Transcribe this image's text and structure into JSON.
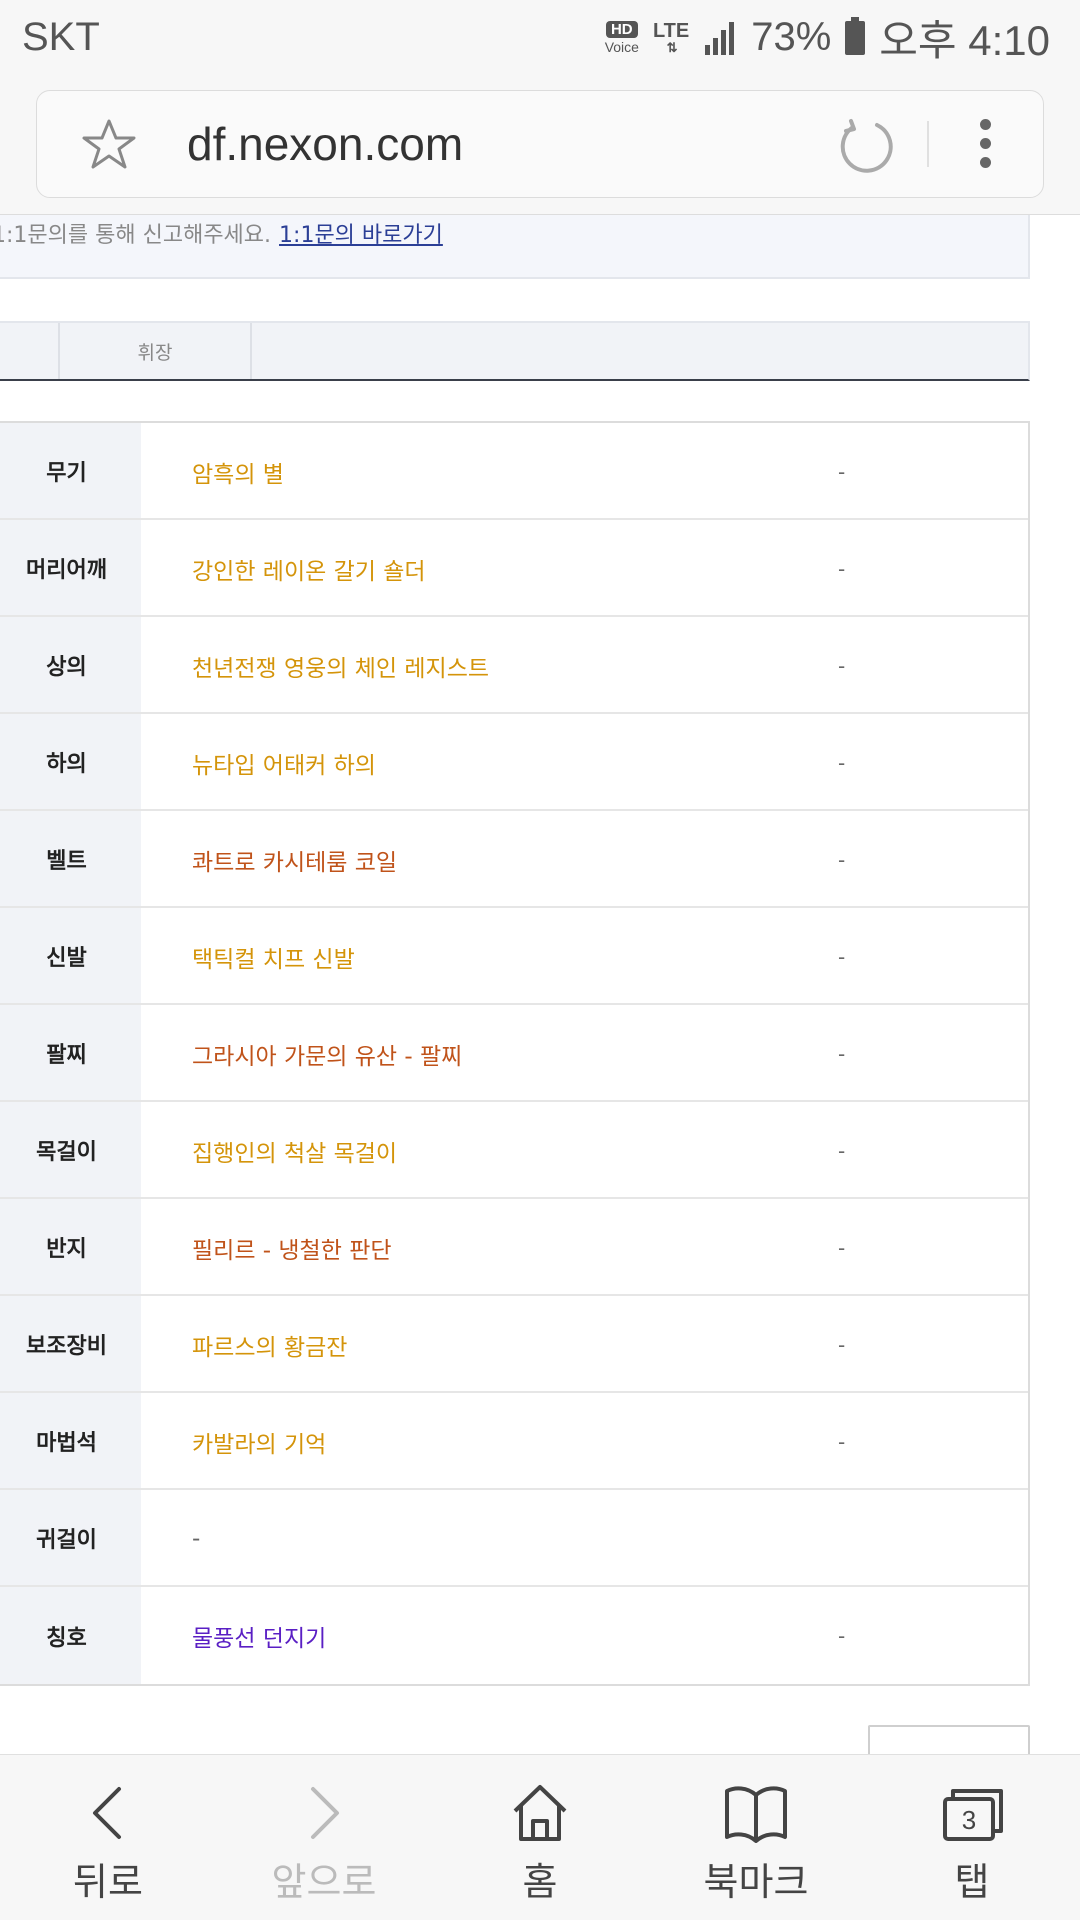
{
  "status_bar": {
    "carrier": "SKT",
    "hd": "HD",
    "voice": "Voice",
    "network": "LTE",
    "battery": "73%",
    "time": "오후 4:10"
  },
  "browser": {
    "url": "df.nexon.com"
  },
  "notice": {
    "text": "1:1문의를 통해 신고해주세요.",
    "link": "1:1문의 바로가기"
  },
  "tabs": {
    "active": "휘장"
  },
  "equipment": [
    {
      "slot": "무기",
      "item": "암흑의 별",
      "color": "#d4940a",
      "extra": "-"
    },
    {
      "slot": "머리어깨",
      "item": "강인한 레이온 갈기 숄더",
      "color": "#d4940a",
      "extra": "-"
    },
    {
      "slot": "상의",
      "item": "천년전쟁 영웅의 체인 레지스트",
      "color": "#d4940a",
      "extra": "-"
    },
    {
      "slot": "하의",
      "item": "뉴타입 어태커 하의",
      "color": "#d4940a",
      "extra": "-"
    },
    {
      "slot": "벨트",
      "item": "콰트로 카시테룸 코일",
      "color": "#c0531a",
      "extra": "-"
    },
    {
      "slot": "신발",
      "item": "택틱컬 치프 신발",
      "color": "#d4940a",
      "extra": "-"
    },
    {
      "slot": "팔찌",
      "item": "그라시아 가문의 유산 - 팔찌",
      "color": "#c0531a",
      "extra": "-"
    },
    {
      "slot": "목걸이",
      "item": "집행인의 척살 목걸이",
      "color": "#d4940a",
      "extra": "-"
    },
    {
      "slot": "반지",
      "item": "필리르 - 냉철한 판단",
      "color": "#c0531a",
      "extra": "-"
    },
    {
      "slot": "보조장비",
      "item": "파르스의 황금잔",
      "color": "#d4940a",
      "extra": "-"
    },
    {
      "slot": "마법석",
      "item": "카발라의 기억",
      "color": "#d4940a",
      "extra": "-"
    },
    {
      "slot": "귀걸이",
      "item": "-",
      "color": "#666666",
      "extra": ""
    },
    {
      "slot": "칭호",
      "item": "물풍선 던지기",
      "color": "#5a1fc4",
      "extra": "-"
    }
  ],
  "bottom_nav": {
    "back": "뒤로",
    "forward": "앞으로",
    "home": "홈",
    "bookmarks": "북마크",
    "tabs": "탭",
    "tab_count": "3"
  }
}
